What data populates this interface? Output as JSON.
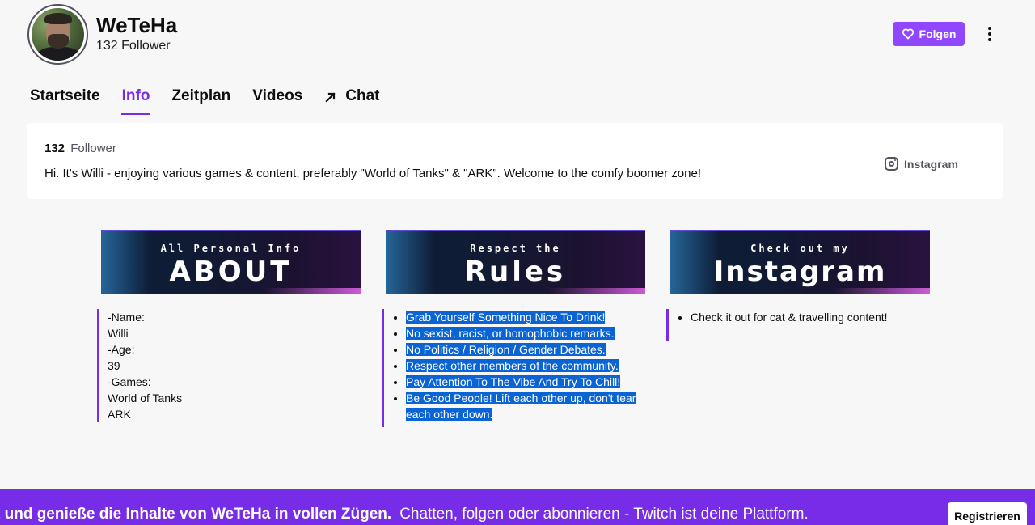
{
  "channel": {
    "name": "WeTeHa",
    "followers": "132 Follower"
  },
  "actions": {
    "follow_label": "Folgen"
  },
  "tabs": [
    {
      "label": "Startseite",
      "active": false
    },
    {
      "label": "Info",
      "active": true
    },
    {
      "label": "Zeitplan",
      "active": false
    },
    {
      "label": "Videos",
      "active": false
    },
    {
      "label": "Chat",
      "active": false
    }
  ],
  "info": {
    "follower_count": "132",
    "follower_label": "Follower",
    "description": "Hi. It's Willi - enjoying various games & content, preferably \"World of Tanks\" & \"ARK\". Welcome to the comfy boomer zone!",
    "social_link": "Instagram"
  },
  "panels": [
    {
      "banner_small": "All Personal Info",
      "banner_big": "ABOUT",
      "lines": [
        "-Name:",
        "Willi",
        "-Age:",
        "39",
        "-Games:",
        "World of Tanks",
        "ARK"
      ]
    },
    {
      "banner_small": "Respect the",
      "banner_big": "Rules",
      "items": [
        "Grab Yourself Something Nice To Drink!",
        "No sexist, racist, or homophobic remarks.",
        "No Politics / Religion / Gender Debates.",
        "Respect other members of the community.",
        "Pay Attention To The Vibe And Try To Chill!",
        "Be Good People! Lift each other up, don't tear each other down."
      ]
    },
    {
      "banner_small": "Check out my",
      "banner_big": "Instagram",
      "items": [
        "Check it out for cat & travelling content!"
      ]
    }
  ],
  "bottom_bar": {
    "bold_text": "t und genieße die Inhalte von WeTeHa in vollen Zügen.",
    "normal_text": "Chatten, folgen oder abonnieren - Twitch ist deine Plattform.",
    "register_label": "Registrieren"
  },
  "colors": {
    "accent": "#9147ff",
    "accent_dark": "#772ce8",
    "selection": "#0a64d4"
  },
  "icons": {
    "follow": "heart-icon",
    "more": "more-vertical-icon",
    "chat": "external-arrow-icon",
    "social": "instagram-icon"
  }
}
